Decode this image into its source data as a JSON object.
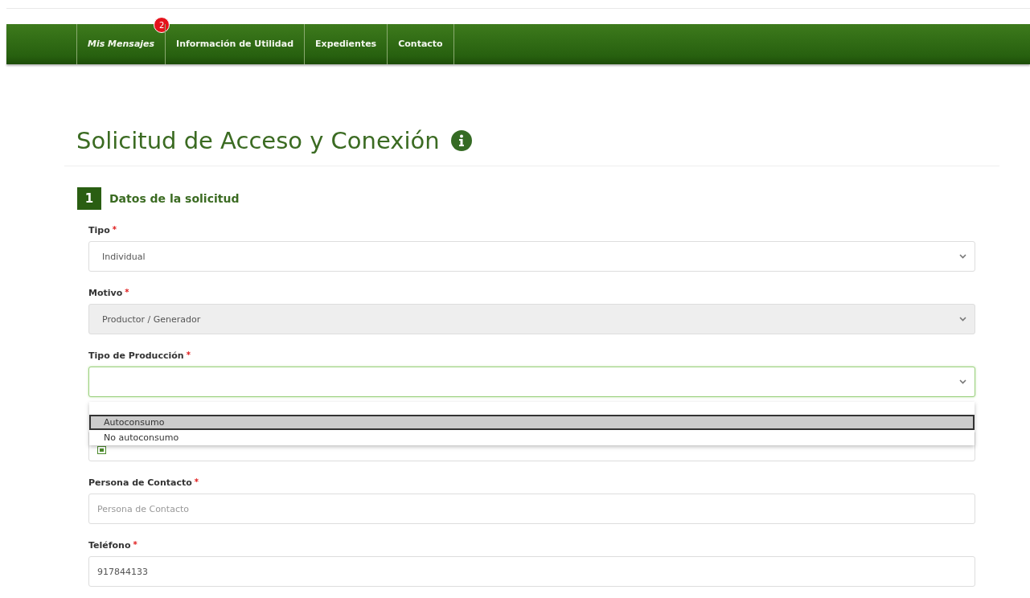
{
  "nav": {
    "items": [
      {
        "label": "Mis Mensajes",
        "badge": "2"
      },
      {
        "label": "Información de Utilidad"
      },
      {
        "label": "Expedientes"
      },
      {
        "label": "Contacto"
      }
    ]
  },
  "page": {
    "title": "Solicitud de Acceso y Conexión"
  },
  "section": {
    "number": "1",
    "title": "Datos de la solicitud"
  },
  "fields": [
    {
      "kind": "select",
      "label": "Tipo",
      "required_mark": "*",
      "value": "Individual",
      "disabled": false,
      "focused": false
    },
    {
      "kind": "select",
      "label": "Motivo",
      "required_mark": "*",
      "value": "Productor / Generador",
      "disabled": true,
      "focused": false
    },
    {
      "kind": "select",
      "label": "Tipo de Producción",
      "required_mark": "*",
      "disabled": false,
      "focused": true,
      "open": true,
      "options": [
        {
          "label": "Autoconsumo",
          "selected": true
        },
        {
          "label": "No autoconsumo",
          "selected": false
        }
      ]
    },
    {
      "kind": "hidden-input"
    },
    {
      "kind": "input",
      "label": "Persona de Contacto",
      "required_mark": "*",
      "placeholder": "Persona de Contacto"
    },
    {
      "kind": "input",
      "label": "Teléfono",
      "required_mark": "*",
      "value": "917844133"
    }
  ]
}
